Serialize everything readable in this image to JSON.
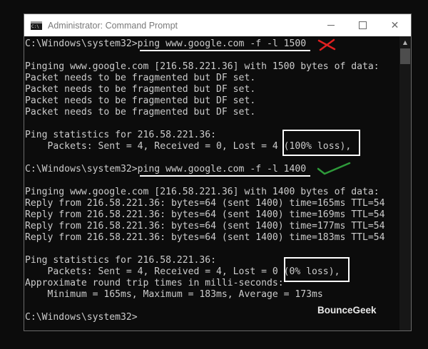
{
  "window": {
    "title": "Administrator: Command Prompt",
    "icon_name": "command-prompt-icon",
    "icon_text": "C:\\",
    "controls": {
      "minimize_icon": "minimize-icon",
      "maximize_icon": "maximize-icon",
      "close_glyph": "✕"
    }
  },
  "terminal": {
    "lines": [
      "C:\\Windows\\system32>ping www.google.com -f -l 1500",
      "",
      "Pinging www.google.com [216.58.221.36] with 1500 bytes of data:",
      "Packet needs to be fragmented but DF set.",
      "Packet needs to be fragmented but DF set.",
      "Packet needs to be fragmented but DF set.",
      "Packet needs to be fragmented but DF set.",
      "",
      "Ping statistics for 216.58.221.36:",
      "    Packets: Sent = 4, Received = 0, Lost = 4 (100% loss),",
      "",
      "C:\\Windows\\system32>ping www.google.com -f -l 1400",
      "",
      "Pinging www.google.com [216.58.221.36] with 1400 bytes of data:",
      "Reply from 216.58.221.36: bytes=64 (sent 1400) time=165ms TTL=54",
      "Reply from 216.58.221.36: bytes=64 (sent 1400) time=169ms TTL=54",
      "Reply from 216.58.221.36: bytes=64 (sent 1400) time=177ms TTL=54",
      "Reply from 216.58.221.36: bytes=64 (sent 1400) time=183ms TTL=54",
      "",
      "Ping statistics for 216.58.221.36:",
      "    Packets: Sent = 4, Received = 4, Lost = 0 (0% loss),",
      "Approximate round trip times in milli-seconds:",
      "    Minimum = 165ms, Maximum = 183ms, Average = 173ms",
      "",
      "C:\\Windows\\system32>"
    ]
  },
  "annotations": {
    "fail_mark_icon": "red-cross-icon",
    "fail_mark_color": "#e02020",
    "success_mark_icon": "green-checkmark-icon",
    "success_mark_color": "#2e9a3a",
    "highlight_color": "#ffffff"
  },
  "watermark": "BounceGeek",
  "colors": {
    "terminal_background": "#0c0c0c",
    "terminal_text": "#cccccc",
    "titlebar_background": "#ffffff"
  }
}
